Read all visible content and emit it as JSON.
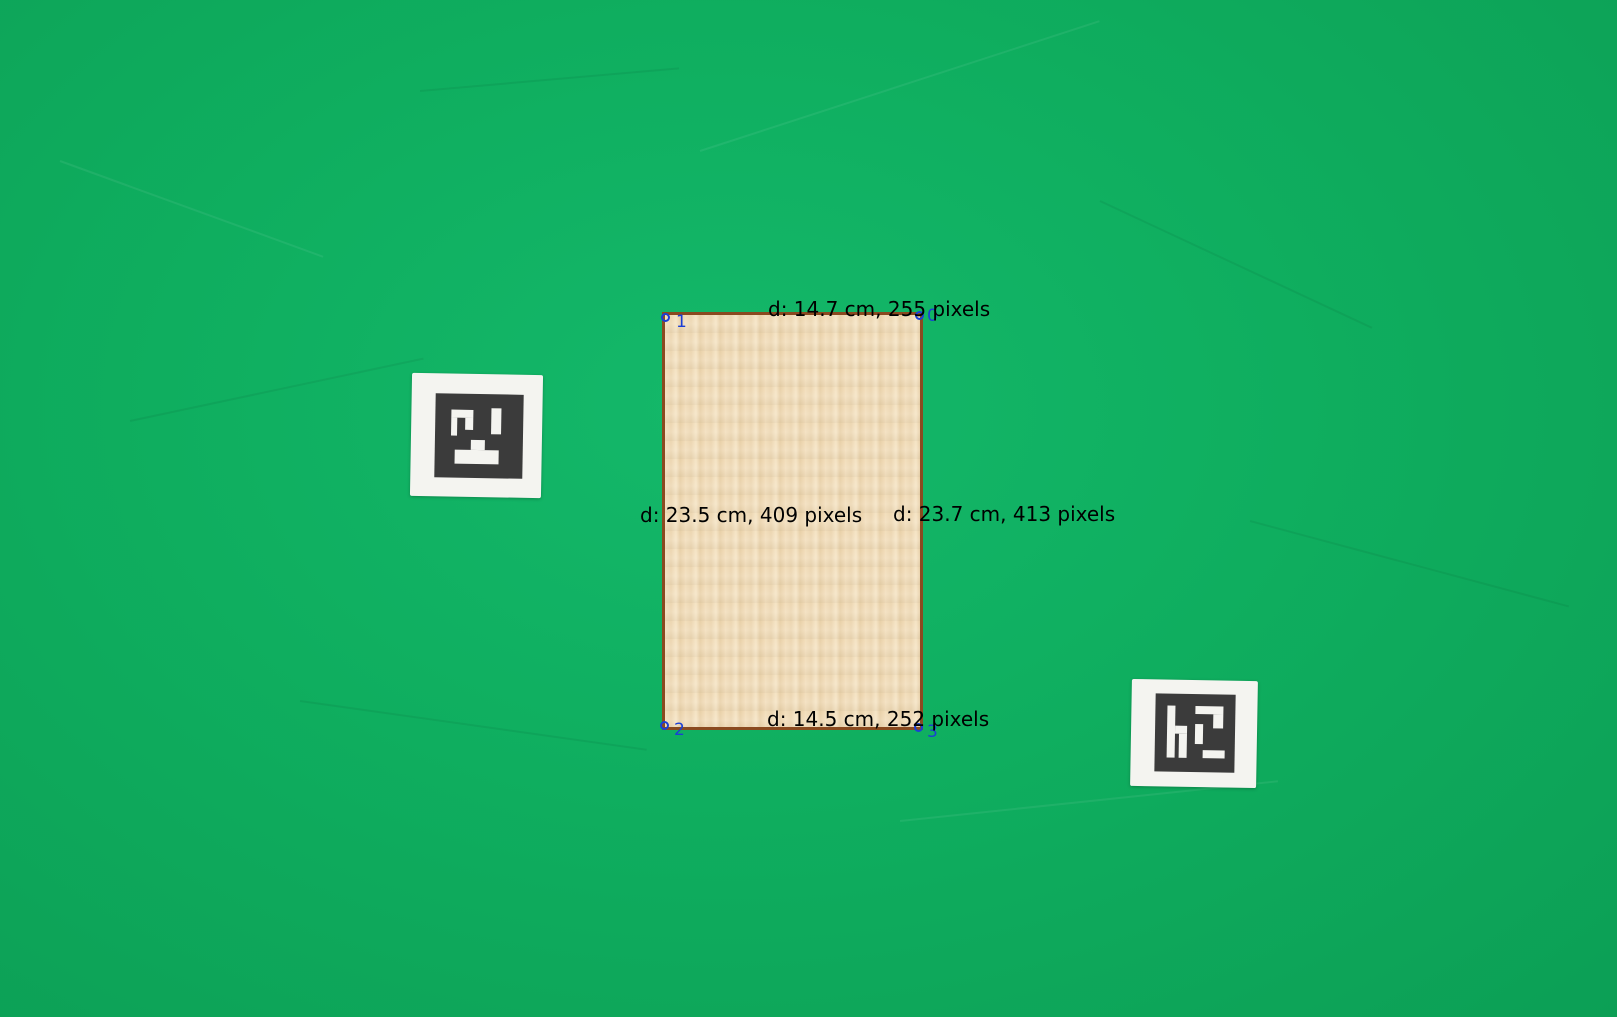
{
  "measurements": {
    "top_edge": "d: 14.7 cm, 255 pixels",
    "bottom_edge": "d: 14.5 cm, 252 pixels",
    "left_edge": "d: 23.5 cm, 409 pixels",
    "right_edge": "d: 23.7 cm, 413 pixels"
  },
  "corners": {
    "c0": "0",
    "c1": "1",
    "c2": "2",
    "c3": "3"
  },
  "colors": {
    "background": "#0fae5f",
    "outline": "#8a4a20",
    "corner_marks": "#1b3fd6"
  }
}
